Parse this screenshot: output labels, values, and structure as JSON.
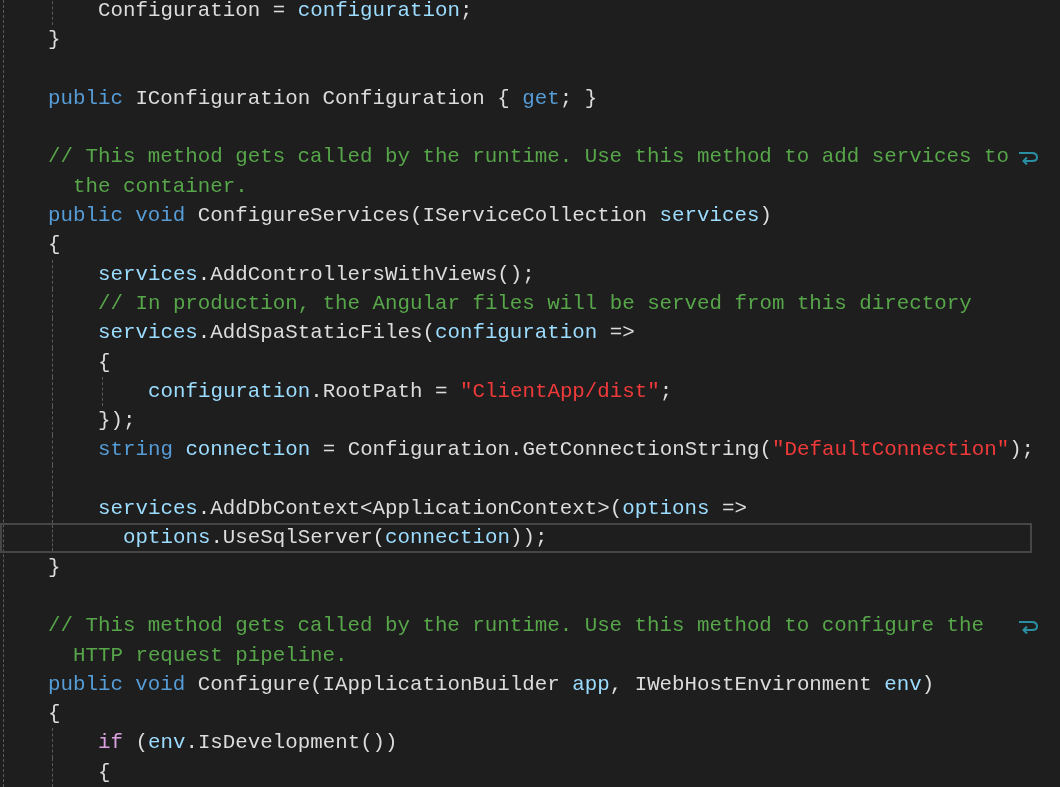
{
  "editor": {
    "rows": [
      {
        "kind": "inner",
        "tokens": [
          {
            "kind": "plain",
            "text": "Configuration ="
          },
          {
            "kind": "variable",
            "text": "configuration",
            "gap": true
          },
          {
            "kind": "plain",
            "text": ";"
          }
        ]
      },
      {
        "kind": "top",
        "tokens": [
          {
            "kind": "plain",
            "text": "}"
          }
        ]
      },
      {
        "kind": "top",
        "tokens": []
      },
      {
        "kind": "top",
        "tokens": [
          {
            "kind": "keyword",
            "text": "public"
          },
          {
            "kind": "plain",
            "text": "IConfiguration Configuration {",
            "gap": true
          },
          {
            "kind": "keyword",
            "text": "get",
            "gap": true
          },
          {
            "kind": "plain",
            "text": "; }"
          }
        ]
      },
      {
        "kind": "top",
        "tokens": []
      },
      {
        "kind": "top",
        "wrapped": true,
        "tokens": [
          {
            "kind": "comment",
            "text": "// This method gets called by the runtime. Use this method to add services to"
          }
        ]
      },
      {
        "kind": "wrap",
        "tokens": [
          {
            "kind": "comment",
            "text": "the container."
          }
        ]
      },
      {
        "kind": "top",
        "tokens": [
          {
            "kind": "keyword",
            "text": "public void"
          },
          {
            "kind": "plain",
            "text": "ConfigureServices(IServiceCollection",
            "gap": true
          },
          {
            "kind": "variable",
            "text": "services",
            "gap": true
          },
          {
            "kind": "plain",
            "text": ")"
          }
        ]
      },
      {
        "kind": "top",
        "tokens": [
          {
            "kind": "plain",
            "text": "{"
          }
        ]
      },
      {
        "kind": "inner",
        "tokens": [
          {
            "kind": "variable",
            "text": "services"
          },
          {
            "kind": "plain",
            "text": ".AddControllersWithViews();"
          }
        ]
      },
      {
        "kind": "inner",
        "tokens": [
          {
            "kind": "comment",
            "text": "// In production, the Angular files will be served from this directory"
          }
        ]
      },
      {
        "kind": "inner",
        "tokens": [
          {
            "kind": "variable",
            "text": "services"
          },
          {
            "kind": "plain",
            "text": ".AddSpaStaticFiles("
          },
          {
            "kind": "variable",
            "text": "configuration"
          },
          {
            "kind": "plain",
            "text": "=>",
            "gap": true
          }
        ]
      },
      {
        "kind": "inner",
        "tokens": [
          {
            "kind": "plain",
            "text": "{"
          }
        ]
      },
      {
        "kind": "deep",
        "tokens": [
          {
            "kind": "variable",
            "text": "configuration"
          },
          {
            "kind": "plain",
            "text": ".RootPath ="
          },
          {
            "kind": "string",
            "text": "\"ClientApp/dist\"",
            "gap": true
          },
          {
            "kind": "plain",
            "text": ";"
          }
        ]
      },
      {
        "kind": "inner",
        "tokens": [
          {
            "kind": "plain",
            "text": "});"
          }
        ]
      },
      {
        "kind": "inner",
        "tokens": [
          {
            "kind": "keyword",
            "text": "string"
          },
          {
            "kind": "variable",
            "text": "connection",
            "gap": true
          },
          {
            "kind": "plain",
            "text": "= Configuration.GetConnectionString(",
            "gap": true
          },
          {
            "kind": "string",
            "text": "\"DefaultConnection\""
          },
          {
            "kind": "plain",
            "text": ");"
          }
        ]
      },
      {
        "kind": "inner",
        "tokens": []
      },
      {
        "kind": "inner",
        "tokens": [
          {
            "kind": "variable",
            "text": "services"
          },
          {
            "kind": "plain",
            "text": ".AddDbContext<ApplicationContext>("
          },
          {
            "kind": "variable",
            "text": "options"
          },
          {
            "kind": "plain",
            "text": "=>",
            "gap": true
          }
        ]
      },
      {
        "kind": "wrap",
        "current": true,
        "tokens": [
          {
            "kind": "variable",
            "text": "options"
          },
          {
            "kind": "plain",
            "text": ".UseSqlServer("
          },
          {
            "kind": "variable",
            "text": "connection"
          },
          {
            "kind": "plain",
            "text": "));"
          }
        ]
      },
      {
        "kind": "top",
        "tokens": [
          {
            "kind": "plain",
            "text": "}"
          }
        ]
      },
      {
        "kind": "top",
        "tokens": []
      },
      {
        "kind": "top",
        "wrapped": true,
        "tokens": [
          {
            "kind": "comment",
            "text": "// This method gets called by the runtime. Use this method to configure the"
          }
        ]
      },
      {
        "kind": "wrap",
        "tokens": [
          {
            "kind": "comment",
            "text": "HTTP request pipeline."
          }
        ]
      },
      {
        "kind": "top",
        "tokens": [
          {
            "kind": "keyword",
            "text": "public void"
          },
          {
            "kind": "plain",
            "text": "Configure(IApplicationBuilder",
            "gap": true
          },
          {
            "kind": "variable",
            "text": "app",
            "gap": true
          },
          {
            "kind": "plain",
            "text": ", IWebHostEnvironment"
          },
          {
            "kind": "variable",
            "text": "env",
            "gap": true
          },
          {
            "kind": "plain",
            "text": ")"
          }
        ]
      },
      {
        "kind": "top",
        "tokens": [
          {
            "kind": "plain",
            "text": "{"
          }
        ]
      },
      {
        "kind": "inner",
        "tokens": [
          {
            "kind": "control",
            "text": "if"
          },
          {
            "kind": "plain",
            "text": "(",
            "gap": true
          },
          {
            "kind": "variable",
            "text": "env"
          },
          {
            "kind": "plain",
            "text": ".IsDevelopment())"
          }
        ]
      },
      {
        "kind": "inner",
        "tokens": [
          {
            "kind": "plain",
            "text": "{"
          }
        ]
      }
    ]
  }
}
